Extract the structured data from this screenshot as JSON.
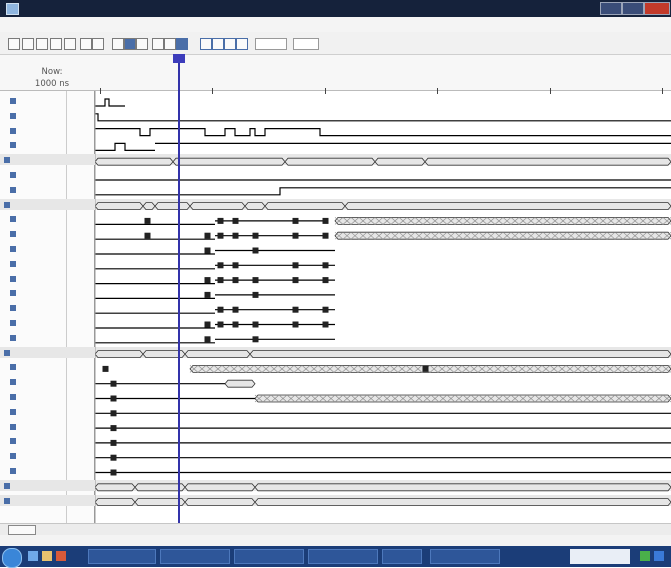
{
  "window": {
    "title": ""
  },
  "menu": [
    "",
    "",
    "",
    "",
    "",
    ""
  ],
  "toolbar": {
    "icons": [
      "new-icon",
      "save-icon",
      "cut-icon",
      "copy-icon",
      "paste-icon",
      "zoom-in-icon",
      "zoom-out-icon",
      "find-icon",
      "marker-icon",
      "arrow-icon",
      "expand-icon",
      "collapse-icon",
      "close-icon",
      "run-icon",
      "step-icon",
      "pause-icon",
      "stop-icon"
    ],
    "time_field_value": "",
    "unit_select_value": ""
  },
  "ruler": {
    "now_label": "Now:",
    "now_value": "1000 ns",
    "ticks": [
      {
        "label": "",
        "t": 0
      },
      {
        "label": "",
        "t": 200
      },
      {
        "label": "",
        "t": 400
      },
      {
        "label": "",
        "t": 600
      },
      {
        "label": "",
        "t": 800
      },
      {
        "label": "",
        "t": 1000
      }
    ],
    "cursor_label": ""
  },
  "signals": [
    {
      "name": "",
      "value": "",
      "group": false
    },
    {
      "name": "",
      "value": "",
      "group": false
    },
    {
      "name": "",
      "value": "",
      "group": false
    },
    {
      "name": "",
      "value": "",
      "group": false
    },
    {
      "name": "",
      "value": "",
      "group": true
    },
    {
      "name": "",
      "value": "",
      "group": false
    },
    {
      "name": "",
      "value": "",
      "group": false
    },
    {
      "name": "",
      "value": "",
      "group": true
    },
    {
      "name": "",
      "value": "",
      "group": false
    },
    {
      "name": "",
      "value": "",
      "group": false
    },
    {
      "name": "",
      "value": "",
      "group": false
    },
    {
      "name": "",
      "value": "",
      "group": false
    },
    {
      "name": "",
      "value": "",
      "group": false
    },
    {
      "name": "",
      "value": "",
      "group": false
    },
    {
      "name": "",
      "value": "",
      "group": false
    },
    {
      "name": "",
      "value": "",
      "group": false
    },
    {
      "name": "",
      "value": "",
      "group": false
    },
    {
      "name": "",
      "value": "",
      "group": true
    },
    {
      "name": "",
      "value": "",
      "group": false
    },
    {
      "name": "",
      "value": "",
      "group": false
    },
    {
      "name": "",
      "value": "",
      "group": false
    },
    {
      "name": "",
      "value": "",
      "group": false
    },
    {
      "name": "",
      "value": "",
      "group": false
    },
    {
      "name": "",
      "value": "",
      "group": false
    },
    {
      "name": "",
      "value": "",
      "group": false
    },
    {
      "name": "",
      "value": "",
      "group": false
    },
    {
      "name": "",
      "value": "",
      "group": true
    },
    {
      "name": "",
      "value": "",
      "group": true
    }
  ],
  "status": {
    "right_text": ""
  },
  "taskbar": {
    "tasks": [
      "",
      "",
      "",
      "",
      "",
      ""
    ],
    "clock": ""
  },
  "colors": {
    "titlebar": "#15223b",
    "cursor": "#3333aa",
    "bus_fill": "#e6e6e6",
    "wave": "#000000",
    "unknown_x": "#8a8a8a",
    "marker": "#3c3cbb",
    "taskbar": "#1b3d78"
  }
}
